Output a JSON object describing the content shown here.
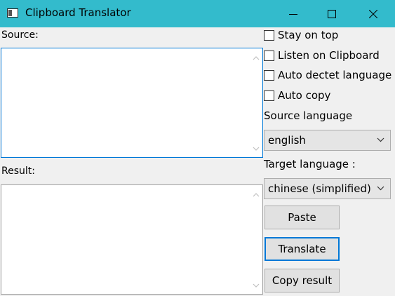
{
  "window": {
    "title": "Clipboard Translator",
    "titlebar_color": "#33bbcc"
  },
  "source": {
    "label": "Source:",
    "value": ""
  },
  "result": {
    "label": "Result:",
    "value": ""
  },
  "options": {
    "stay_on_top": {
      "label": "Stay on top",
      "checked": false
    },
    "listen_clipboard": {
      "label": "Listen on Clipboard",
      "checked": false
    },
    "auto_detect": {
      "label": "Auto dectet language",
      "checked": false
    },
    "auto_copy": {
      "label": "Auto copy",
      "checked": false
    }
  },
  "source_language": {
    "label": "Source language",
    "selected": "english"
  },
  "target_language": {
    "label": "Target language :",
    "selected": "chinese (simplified)"
  },
  "buttons": {
    "paste": "Paste",
    "translate": "Translate",
    "copy_result": "Copy result"
  },
  "accent_color": "#0078d7"
}
